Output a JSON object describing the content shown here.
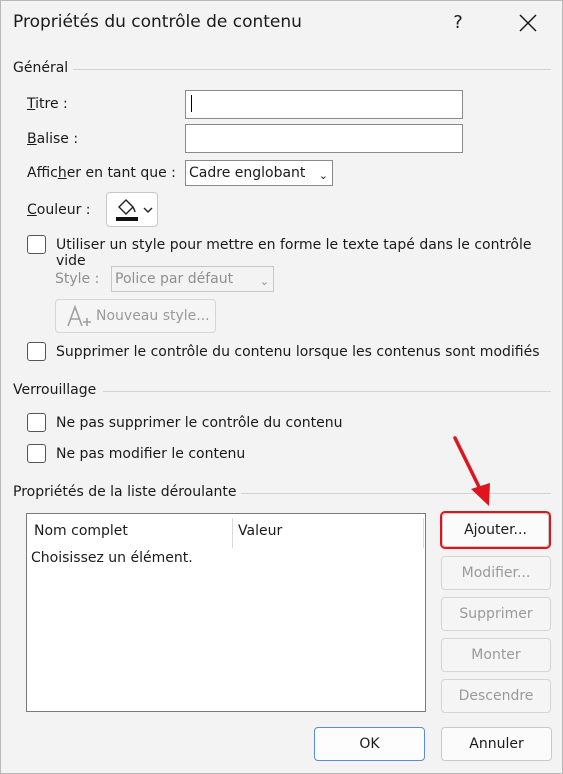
{
  "window": {
    "title": "Propriétés du contrôle de contenu",
    "help_label": "?"
  },
  "general": {
    "section_label": "Général",
    "title_label": "Titre :",
    "title_value": "",
    "tag_label": "Balise :",
    "tag_value": "",
    "display_label": "Afficher en tant que :",
    "display_value": "Cadre englobant",
    "color_label": "Couleur :",
    "use_style_label": "Utiliser un style pour mettre en forme le texte tapé dans le contrôle vide",
    "use_style_checked": false,
    "style_label": "Style :",
    "style_value": "Police par défaut",
    "new_style_label": "Nouveau style...",
    "remove_control_label": "Supprimer le contrôle du contenu lorsque les contenus sont modifiés",
    "remove_control_checked": false
  },
  "locking": {
    "section_label": "Verrouillage",
    "no_delete_label": "Ne pas supprimer le contrôle du contenu",
    "no_delete_checked": false,
    "no_edit_label": "Ne pas modifier le contenu",
    "no_edit_checked": false
  },
  "dropdown": {
    "section_label": "Propriétés de la liste déroulante",
    "columns": [
      "Nom complet",
      "Valeur"
    ],
    "rows": [
      {
        "name": "Choisissez un élément.",
        "value": ""
      }
    ],
    "buttons": {
      "add": "Ajouter...",
      "modify": "Modifier...",
      "delete": "Supprimer",
      "up": "Monter",
      "down": "Descendre"
    }
  },
  "footer": {
    "ok": "OK",
    "cancel": "Annuler"
  },
  "colors": {
    "accent_highlight": "#e0141e",
    "primary_border": "#5a8dd0",
    "background": "#f3f3f3"
  },
  "icons": [
    "close-icon",
    "paint-bucket-icon",
    "chevron-down-icon",
    "new-style-icon",
    "annotation-arrow"
  ]
}
